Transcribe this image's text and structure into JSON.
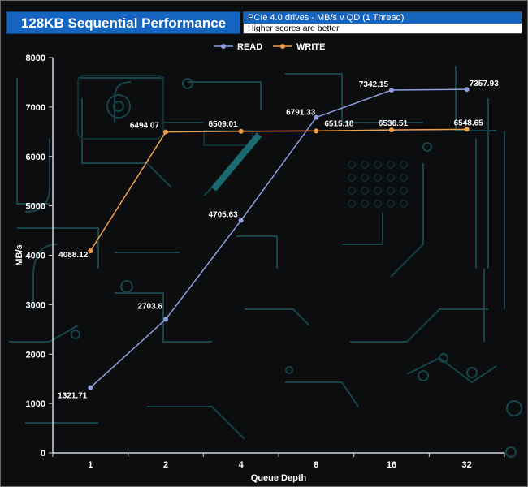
{
  "header": {
    "title": "128KB Sequential Performance",
    "subtitle": "PCIe 4.0 drives - MB/s v QD (1 Thread)",
    "note": "Higher scores are better"
  },
  "colors": {
    "read": "#8e9fe0",
    "write": "#f0a04b",
    "title_bg": "#1565c0"
  },
  "chart_data": {
    "type": "line",
    "title": "128KB Sequential Performance",
    "xlabel": "Queue Depth",
    "ylabel": "MB/s",
    "categories": [
      "1",
      "2",
      "4",
      "8",
      "16",
      "32"
    ],
    "ylim": [
      0,
      8000
    ],
    "yticks": [
      "0",
      "1000",
      "2000",
      "3000",
      "4000",
      "5000",
      "6000",
      "7000",
      "8000"
    ],
    "grid": false,
    "legend": "top",
    "series": [
      {
        "name": "READ",
        "values": [
          1321.71,
          2703.6,
          4705.63,
          6791.33,
          7342.15,
          7357.93
        ],
        "labels": [
          "1321.71",
          "2703.6",
          "4705.63",
          "6791.33",
          "7342.15",
          "7357.93"
        ]
      },
      {
        "name": "WRITE",
        "values": [
          4088.12,
          6494.07,
          6509.01,
          6515.18,
          6536.51,
          6548.65
        ],
        "labels": [
          "4088.12",
          "6494.07",
          "6509.01",
          "6515.18",
          "6536.51",
          "6548.65"
        ]
      }
    ]
  }
}
